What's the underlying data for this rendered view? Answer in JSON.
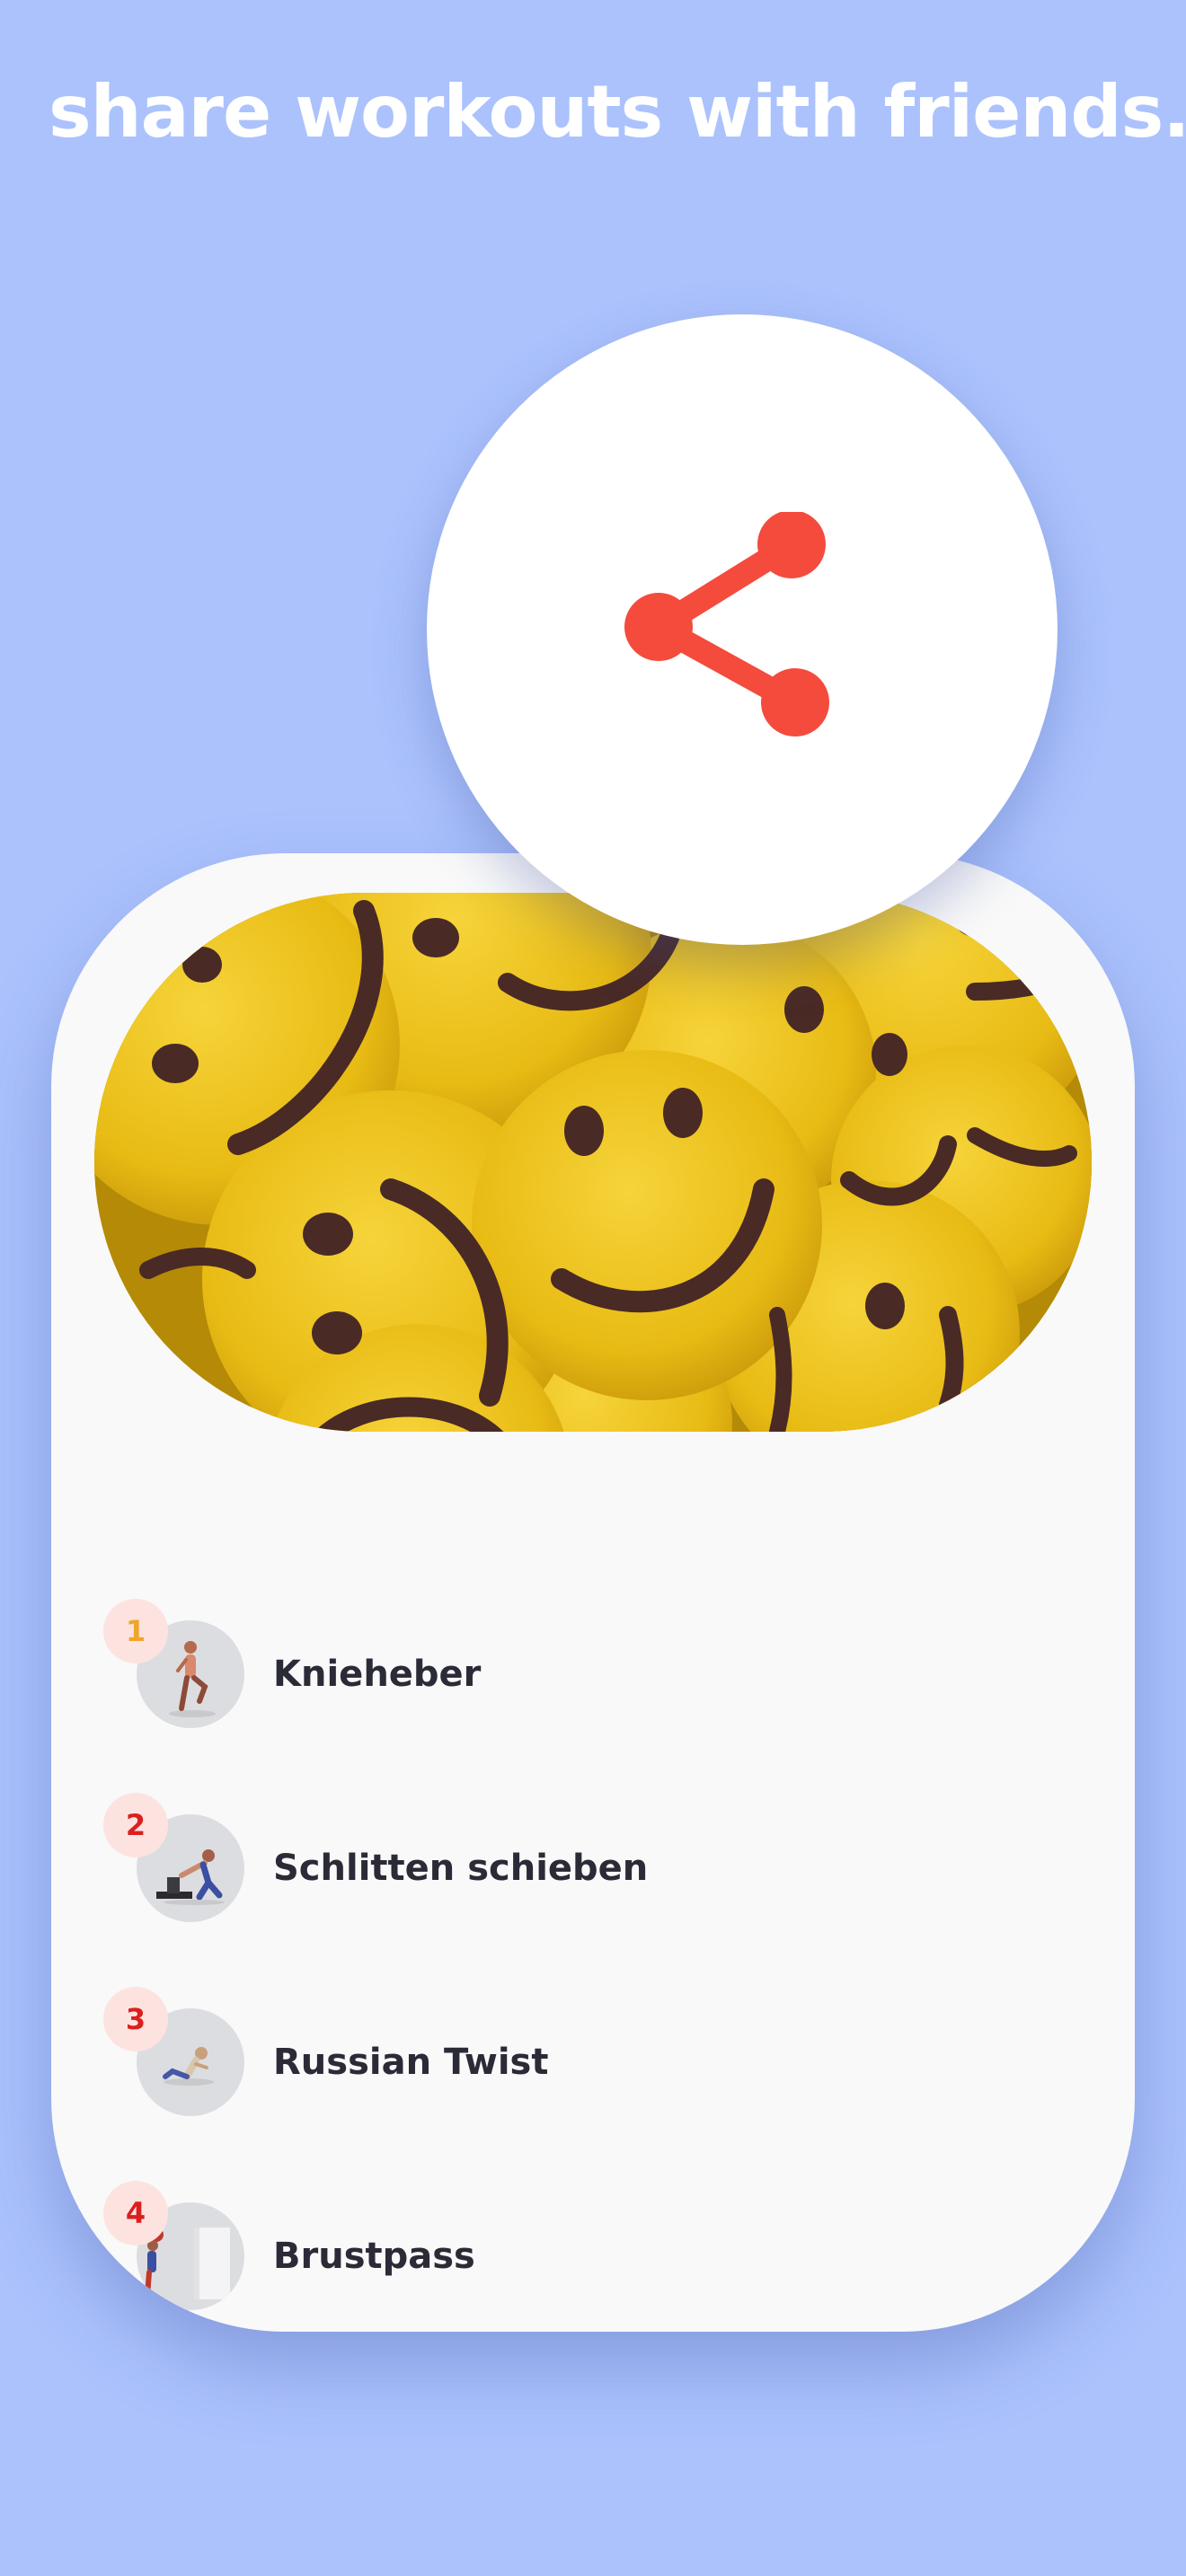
{
  "headline": "share workouts with friends.",
  "colors": {
    "background": "#abc2fd",
    "card": "#f9f9f9",
    "accent": "#f44b3d",
    "number_first": "#f0a42b",
    "number_other": "#db1f1f",
    "number_badge_bg": "#fde3df",
    "text_dark": "#2b2b38"
  },
  "share_button": {
    "icon": "share-icon"
  },
  "hero_image": {
    "description_icon": "smiley-faces-image"
  },
  "exercises": [
    {
      "number": "1",
      "name": "Knieheber",
      "icon": "knee-raise-figure"
    },
    {
      "number": "2",
      "name": "Schlitten schieben",
      "icon": "sled-push-figure"
    },
    {
      "number": "3",
      "name": "Russian Twist",
      "icon": "russian-twist-figure"
    },
    {
      "number": "4",
      "name": "Brustpass",
      "icon": "chest-pass-figure"
    }
  ]
}
